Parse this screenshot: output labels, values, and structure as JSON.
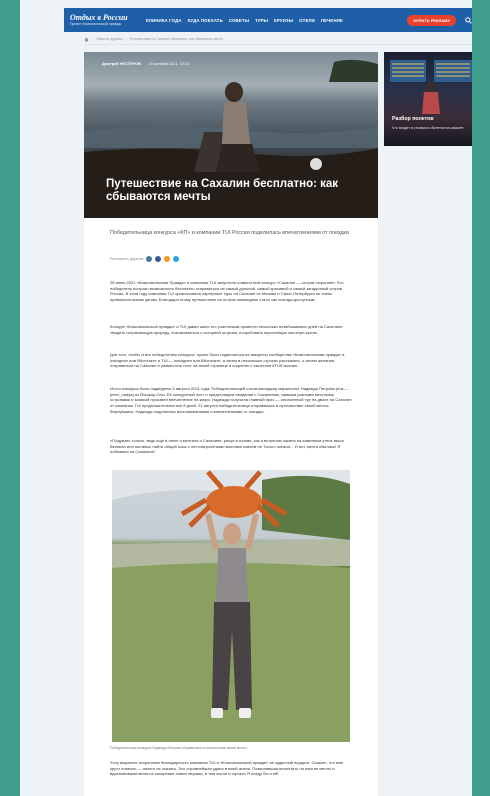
{
  "header": {
    "logo_title": "Отдых в России",
    "logo_subtitle": "Проект Комсомольской правды",
    "nav": [
      "КЛИНИКА ГОДА",
      "КУДА ПОЕХАТЬ",
      "СОВЕТЫ",
      "ТУРЫ",
      "КРУИЗЫ",
      "ОТЕЛИ",
      "ЛЕЧЕНИЕ"
    ],
    "cta_label": "КУПИТЬ РЕКЛАМУ",
    "search_icon": "search-icon"
  },
  "breadcrumbs": [
    "Новости дружбы",
    "Путешествие на Сахалин бесплатно: как сбываются мечты"
  ],
  "article": {
    "author": "Дмитрий НЕСТЕРОВ",
    "date": "15 октября 2021, 14:15",
    "title": "Путешествие на Сахалин бесплатно: как сбываются мечты",
    "lead": "Победительница конкурса «КП» и компании TUI Россия поделилась впечатлениями от поездки",
    "share_label": "Рассказать друзьям",
    "paragraphs": [
      "25 июля 2021 «Комсомольская Правда» и компания TUI запустили совместный конкурс «Сахалин — остров открытий». Его победитель получал возможность бесплатно отправиться на самый дальний, самый красивый и самый загадочный остров России. В этом году компания TUI организовала чартерные туры на Сахалин из Москвы и Санкт-Петербурга по очень привлекательным ценам. Благодаря этому путешествие на остров заповедник стало как никогда доступным.",
      "Конкурс «Комсомольской правды» и TUI давал шанс его участникам провести несколько незабываемых дней на Сахалине. Увидеть потрясающую природу, познакомиться с историей острова, попробовать вкуснейшую местную кухню.",
      "Для того, чтобы стать победителем конкурса, нужно было подписаться на аккаунты сообщества «Комсомольская правда» в Instagram или ВКонтакте и TUI — Instagram или ВКонтакте, а затем в нескольких строках рассказать, о своем желании отправиться на Сахалин и разместить пост на своей странице в соцсетях с хэштегом #TUIСахалин.",
      "Итоги конкурса были подведены 5 августа 2021 года. Победительницей стала менеджер маркетолог Надежда Петрова (ник — petrn_nadya) из Йошкар-Олы. Её конкурсный пост о предстоящем свидании с Сахалином, самыми разными местными островами и заявкой произвел впечатление на жюри. Надежда получила главный приз — оплаченный тур на двоих на Сахалин от компании TUI продолжительностью 8 дней. 21 августа победительница отправилась в путешествие своей мечты. Вернувшись, Надежда поделилась воспоминаниями и впечатлениями от поездки.",
      "«Подумать только, ведь ещё в июле я мечтала о Сахалине, рисуя в голове, как я встречаю закаты на каменном утесе мыса Великан или пытаюсь найти общий язык с нестовероятными волнами совсем не Тихого океана… И вот, мечта сбылась! Я побывала на Сахалине!",
      "Хочу выразить искреннюю благодарность компании TUI и «Комсомольской правде» за чудесный подарок. Сказать, что мне круто повезло — ничего не сказать. Это огромнейшая удача в моей жизни. Позволившая воплотить на многие мечты и вдохновившая меня на покорение новых вершин, в том числе и горных! Я поеду бы и ей!"
    ],
    "photo_caption": "Победительница конкурса Надежда Петрова отправилась в путешествие своей мечты."
  },
  "sidebar": {
    "title": "Разбор полетов",
    "subtitle": "Что входит в стоимость билетов на самолет"
  },
  "colors": {
    "brand": "#1f5fa8",
    "accent": "#e8422f",
    "highlight": "#d28a1e",
    "background": "#3f9e8c"
  }
}
